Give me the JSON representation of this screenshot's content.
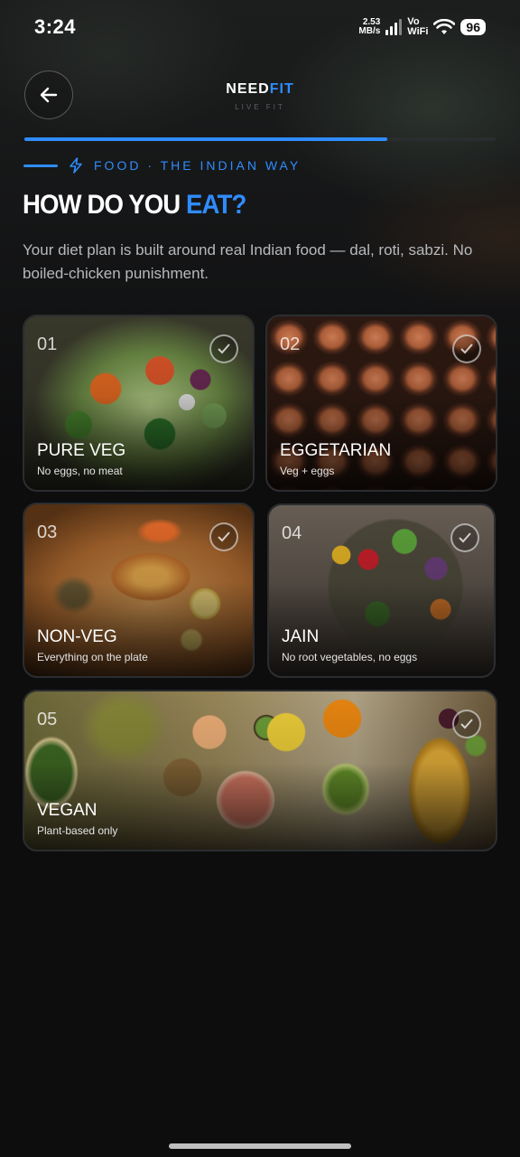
{
  "status_bar": {
    "time": "3:24",
    "net_speed_value": "2.53",
    "net_speed_unit": "MB/s",
    "volte_top": "Vo",
    "volte_bottom": "WiFi",
    "battery": "96"
  },
  "header": {
    "brand_main": "NEED",
    "brand_accent": "FIT",
    "brand_tagline": "LIVE FIT",
    "progress": 0.77
  },
  "eyebrow": "FOOD · THE INDIAN WAY",
  "title": {
    "main": "HOW DO YOU ",
    "accent": "EAT?"
  },
  "subtitle": "Your diet plan is built around real Indian food — dal, roti, sabzi. No boiled-chicken punishment.",
  "options": [
    {
      "num": "01",
      "label": "PURE VEG",
      "desc": "No eggs, no meat"
    },
    {
      "num": "02",
      "label": "EGGETARIAN",
      "desc": "Veg + eggs"
    },
    {
      "num": "03",
      "label": "NON-VEG",
      "desc": "Everything on the plate"
    },
    {
      "num": "04",
      "label": "JAIN",
      "desc": "No root vegetables, no eggs"
    },
    {
      "num": "05",
      "label": "VEGAN",
      "desc": "Plant-based only"
    }
  ],
  "colors": {
    "accent": "#2f8cff",
    "background": "#0d0d0e"
  }
}
